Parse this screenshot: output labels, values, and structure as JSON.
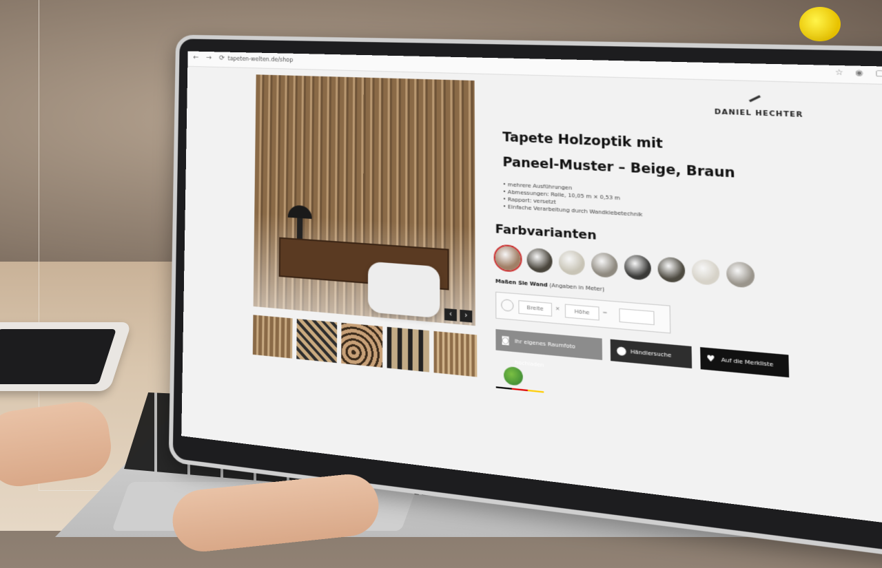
{
  "browser": {
    "url": "tapeten-welten.de/shop"
  },
  "brand": {
    "name": "DANIEL HECHTER"
  },
  "product": {
    "title_line1": "Tapete Holzoptik mit",
    "title_line2": "Paneel-Muster – Beige, Braun",
    "bullets": [
      "• mehrere Ausführungen",
      "• Abmessungen: Rolle, 10,05 m × 0,53 m",
      "• Rapport: versetzt",
      "• Einfache Verarbeitung durch Wandklebetechnik"
    ],
    "variants_heading": "Farbvarianten",
    "swatches": [
      "#a07f66",
      "#4a463d",
      "#c8c4b6",
      "#8f8a80",
      "#3a3a38",
      "#4d4a40",
      "#d6d2c8",
      "#9a958c"
    ],
    "dimensions_label": "Maßen Sie Wand",
    "dimensions_hint": "(Angaben in Meter)",
    "width_placeholder": "Breite",
    "height_placeholder": "Höhe",
    "times_sep": "×",
    "equals_sep": "=",
    "result_value": ""
  },
  "buttons": {
    "upload": "Ihr eigenes Raumfoto hochladen",
    "map": "Händlersuche",
    "favorite": "Auf die Merkliste"
  },
  "icons": {
    "camera": "camera-icon",
    "map_pin": "map-pin-icon",
    "heart": "heart-icon",
    "prev": "chevron-left-icon",
    "next": "chevron-right-icon"
  }
}
